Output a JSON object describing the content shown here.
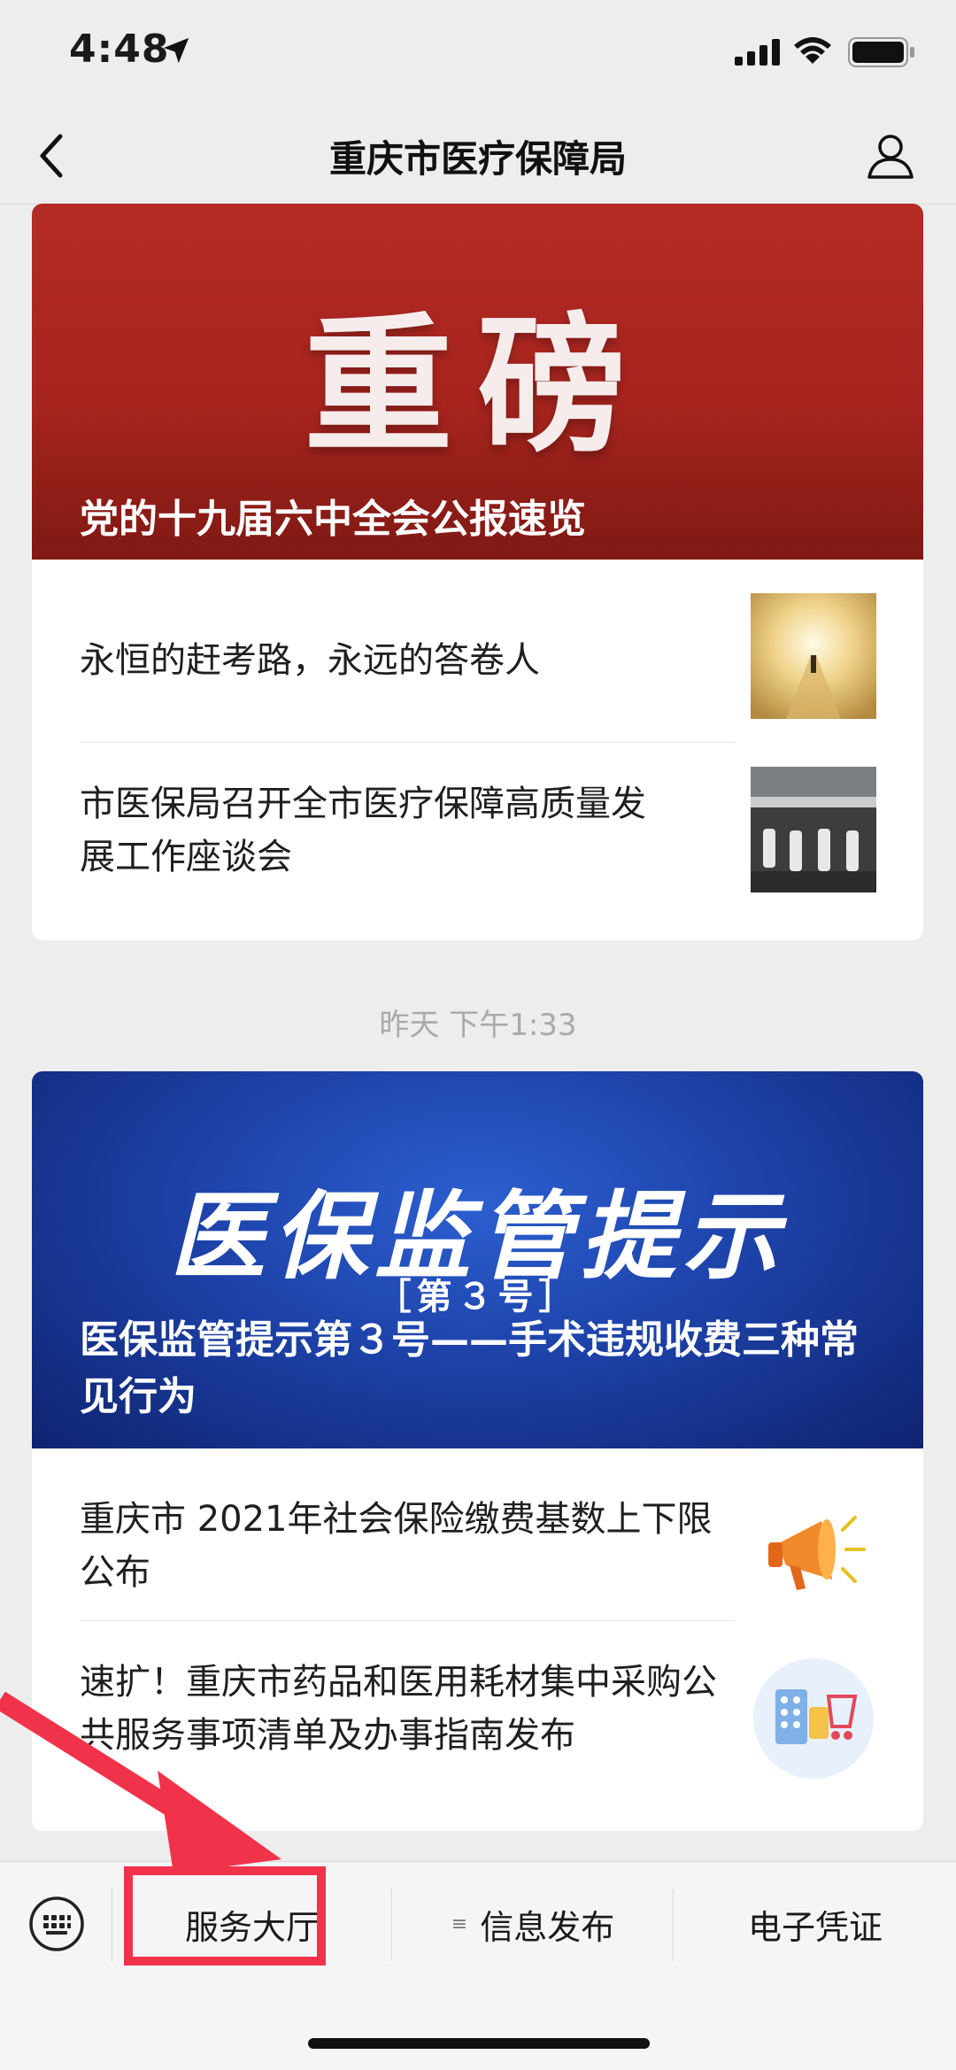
{
  "status_bar": {
    "time": "4:48"
  },
  "nav": {
    "title": "重庆市医疗保障局"
  },
  "card1": {
    "banner_title": "重磅",
    "banner_caption": "党的十九届六中全会公报速览",
    "items": [
      {
        "title_line1": "永恒的赶考路，永远的答卷人"
      },
      {
        "title_line1": "市医保局召开全市医疗保障高质量发",
        "title_line2": "展工作座谈会"
      }
    ]
  },
  "timestamp": "昨天 下午1:33",
  "card2": {
    "banner_title": "医保监管提示",
    "banner_sub": "［第３号］",
    "banner_caption": "医保监管提示第３号——手术违规收费三种常见行为",
    "items": [
      {
        "title": "重庆市 2021年社会保险缴费基数上下限公布"
      },
      {
        "title": "速扩！重庆市药品和医用耗材集中采购公共服务事项清单及办事指南发布"
      }
    ]
  },
  "bottom_menu": {
    "items": [
      {
        "label": "服务大厅"
      },
      {
        "label": "信息发布",
        "lines_icon": "≡"
      },
      {
        "label": "电子凭证"
      }
    ]
  },
  "colors": {
    "banner_red": "#a8241e",
    "banner_blue": "#1d42a8",
    "annotation_red": "#f0334a"
  },
  "icons": [
    "location-arrow-icon",
    "signal-icon",
    "wifi-icon",
    "battery-icon",
    "back-icon",
    "profile-icon",
    "keyboard-icon"
  ]
}
